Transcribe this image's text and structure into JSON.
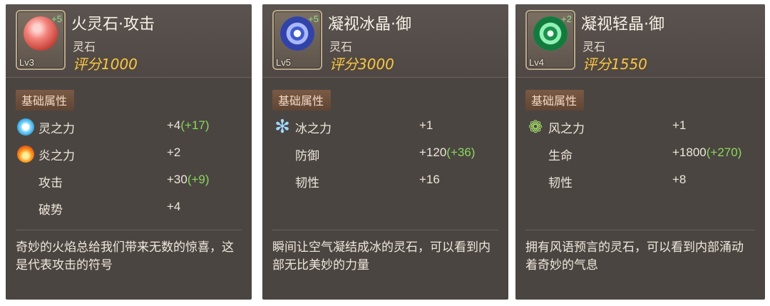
{
  "cards": [
    {
      "name": "火灵石·攻击",
      "type": "灵石",
      "score": "评分1000",
      "level": "Lv3",
      "plus": "+5",
      "gem_color": "red",
      "section": "基础属性",
      "stats": [
        {
          "icon": "spirit-icon",
          "name": "灵之力",
          "value": "+4",
          "bonus": "(+17)"
        },
        {
          "icon": "flame-icon",
          "name": "炎之力",
          "value": "+2",
          "bonus": ""
        },
        {
          "icon": "",
          "name": "攻击",
          "value": "+30",
          "bonus": "(+9)"
        },
        {
          "icon": "",
          "name": "破势",
          "value": "+4",
          "bonus": ""
        }
      ],
      "description": "奇妙的火焰总给我们带来无数的惊喜，这是代表攻击的符号"
    },
    {
      "name": "凝视冰晶·御",
      "type": "灵石",
      "score": "评分3000",
      "level": "Lv5",
      "plus": "+5",
      "gem_color": "blue",
      "section": "基础属性",
      "stats": [
        {
          "icon": "snowflake-icon",
          "name": "冰之力",
          "value": "+1",
          "bonus": ""
        },
        {
          "icon": "",
          "name": "防御",
          "value": "+120",
          "bonus": "(+36)"
        },
        {
          "icon": "",
          "name": "韧性",
          "value": "+16",
          "bonus": ""
        }
      ],
      "description": "瞬间让空气凝结成冰的灵石，可以看到内部无比美妙的力量"
    },
    {
      "name": "凝视轻晶·御",
      "type": "灵石",
      "score": "评分1550",
      "level": "Lv4",
      "plus": "+2",
      "gem_color": "green",
      "section": "基础属性",
      "stats": [
        {
          "icon": "wind-icon",
          "name": "风之力",
          "value": "+1",
          "bonus": ""
        },
        {
          "icon": "",
          "name": "生命",
          "value": "+1800",
          "bonus": "(+270)"
        },
        {
          "icon": "",
          "name": "韧性",
          "value": "+8",
          "bonus": ""
        }
      ],
      "description": "拥有风语预言的灵石，可以看到内部涌动着奇妙的气息"
    }
  ],
  "colors": {
    "panel_bg": "#4b4542",
    "score_gold": "#f0c65a",
    "bonus_green": "#89d85a",
    "section_tag": "#6a4d3a"
  }
}
